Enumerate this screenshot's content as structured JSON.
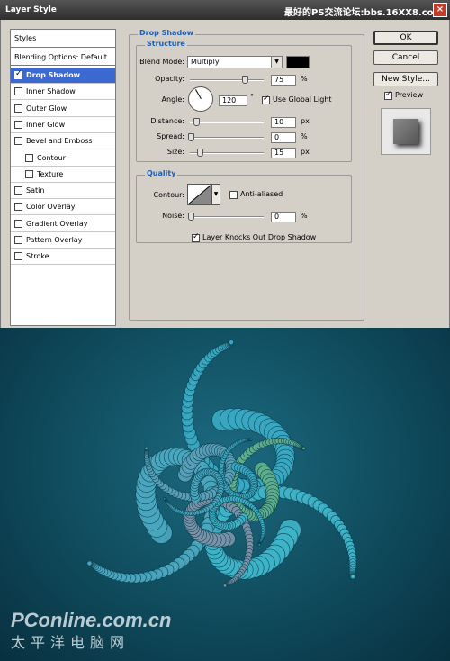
{
  "window": {
    "title": "Layer Style",
    "watermark_text": "最好的PS交流论坛:bbs.16XX8.com",
    "close_glyph": "×"
  },
  "styles_list": {
    "header": "Styles",
    "blending_options": "Blending Options: Default",
    "items": [
      {
        "label": "Drop Shadow",
        "checked": true,
        "selected": true,
        "sub": false
      },
      {
        "label": "Inner Shadow",
        "checked": false,
        "selected": false,
        "sub": false
      },
      {
        "label": "Outer Glow",
        "checked": false,
        "selected": false,
        "sub": false
      },
      {
        "label": "Inner Glow",
        "checked": false,
        "selected": false,
        "sub": false
      },
      {
        "label": "Bevel and Emboss",
        "checked": false,
        "selected": false,
        "sub": false
      },
      {
        "label": "Contour",
        "checked": false,
        "selected": false,
        "sub": true
      },
      {
        "label": "Texture",
        "checked": false,
        "selected": false,
        "sub": true
      },
      {
        "label": "Satin",
        "checked": false,
        "selected": false,
        "sub": false
      },
      {
        "label": "Color Overlay",
        "checked": false,
        "selected": false,
        "sub": false
      },
      {
        "label": "Gradient Overlay",
        "checked": false,
        "selected": false,
        "sub": false
      },
      {
        "label": "Pattern Overlay",
        "checked": false,
        "selected": false,
        "sub": false
      },
      {
        "label": "Stroke",
        "checked": false,
        "selected": false,
        "sub": false
      }
    ]
  },
  "drop_shadow": {
    "section_title": "Drop Shadow",
    "structure": {
      "title": "Structure",
      "blend_mode_label": "Blend Mode:",
      "blend_mode_value": "Multiply",
      "shadow_color": "#000000",
      "opacity_label": "Opacity:",
      "opacity_value": "75",
      "opacity_unit": "%",
      "angle_label": "Angle:",
      "angle_value": "120",
      "angle_unit": "°",
      "use_global_light_label": "Use Global Light",
      "use_global_light_checked": true,
      "distance_label": "Distance:",
      "distance_value": "10",
      "distance_unit": "px",
      "spread_label": "Spread:",
      "spread_value": "0",
      "spread_unit": "%",
      "size_label": "Size:",
      "size_value": "15",
      "size_unit": "px"
    },
    "quality": {
      "title": "Quality",
      "contour_label": "Contour:",
      "anti_aliased_label": "Anti-aliased",
      "anti_aliased_checked": false,
      "noise_label": "Noise:",
      "noise_value": "0",
      "noise_unit": "%"
    },
    "knockout_label": "Layer Knocks Out Drop Shadow",
    "knockout_checked": true
  },
  "buttons": {
    "ok": "OK",
    "cancel": "Cancel",
    "new_style": "New Style...",
    "preview_label": "Preview",
    "preview_checked": true
  },
  "artwork": {
    "description_icon": "fractal-spiral-image",
    "background_color": "#0f4b5d",
    "watermark_line1": "PConline.com.cn",
    "watermark_line2": "太平洋电脑网"
  }
}
